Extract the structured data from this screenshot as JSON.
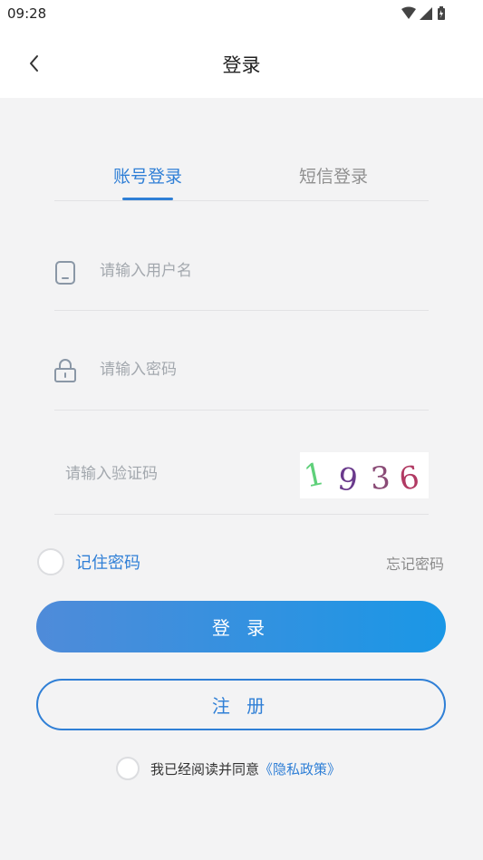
{
  "status_bar": {
    "time": "09:28",
    "icons": [
      "wifi-icon",
      "signal-icon",
      "battery-icon"
    ]
  },
  "header": {
    "title": "登录",
    "back_icon": "chevron-left-icon"
  },
  "tabs": [
    {
      "label": "账号登录",
      "active": true
    },
    {
      "label": "短信登录",
      "active": false
    }
  ],
  "form": {
    "username": {
      "placeholder": "请输入用户名",
      "value": "",
      "icon": "phone-icon"
    },
    "password": {
      "placeholder": "请输入密码",
      "value": "",
      "icon": "lock-icon"
    },
    "captcha": {
      "placeholder": "请输入验证码",
      "value": "",
      "code": "1936"
    }
  },
  "options": {
    "remember_label": "记住密码",
    "forgot_label": "忘记密码"
  },
  "buttons": {
    "login_label": "登 录",
    "register_label": "注 册"
  },
  "agreement": {
    "text": "我已经阅读并同意",
    "link": "《隐私政策》"
  },
  "colors": {
    "accent": "#2f7fd6",
    "gradient_start": "#4f8bd9",
    "gradient_end": "#1a97e6",
    "background": "#f3f3f4",
    "captcha_digit_colors": [
      "#5fd07a",
      "#6a3a8c",
      "#8a4b76",
      "#b13a63"
    ]
  }
}
